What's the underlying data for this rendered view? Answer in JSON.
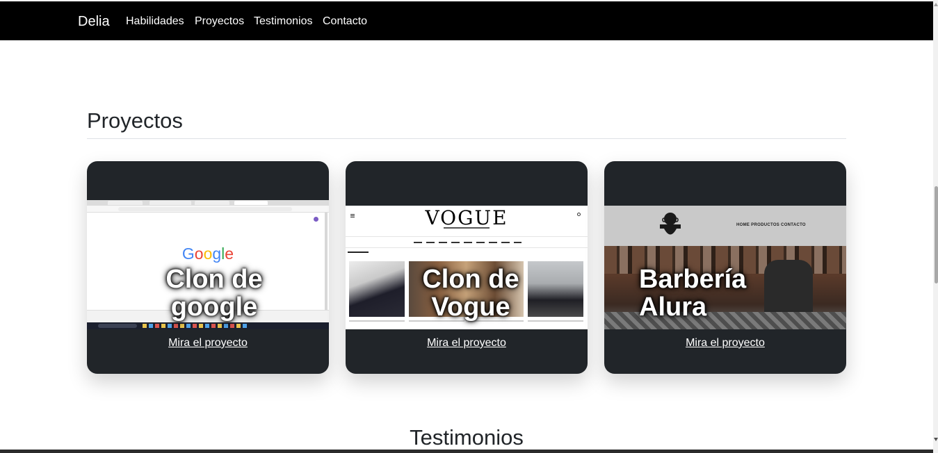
{
  "nav": {
    "brand": "Delia",
    "links": [
      "Habilidades",
      "Proyectos",
      "Testimonios",
      "Contacto"
    ]
  },
  "projects": {
    "title": "Proyectos",
    "cards": [
      {
        "caption": "Clon de google",
        "link": "Mira el proyecto",
        "screenshot_text": "Google"
      },
      {
        "caption": "Clon de Vogue",
        "link": "Mira el proyecto",
        "screenshot_text": "VOGUE"
      },
      {
        "caption": "Barbería Alura",
        "link": "Mira el proyecto",
        "screenshot_text": "HOME  PRODUCTOS  CONTACTO"
      }
    ]
  },
  "testimonials": {
    "title": "Testimonios"
  },
  "colors": {
    "navbar_bg": "#000000",
    "card_bg": "#212529",
    "text_dark": "#212529",
    "link_text": "#ffffff"
  }
}
